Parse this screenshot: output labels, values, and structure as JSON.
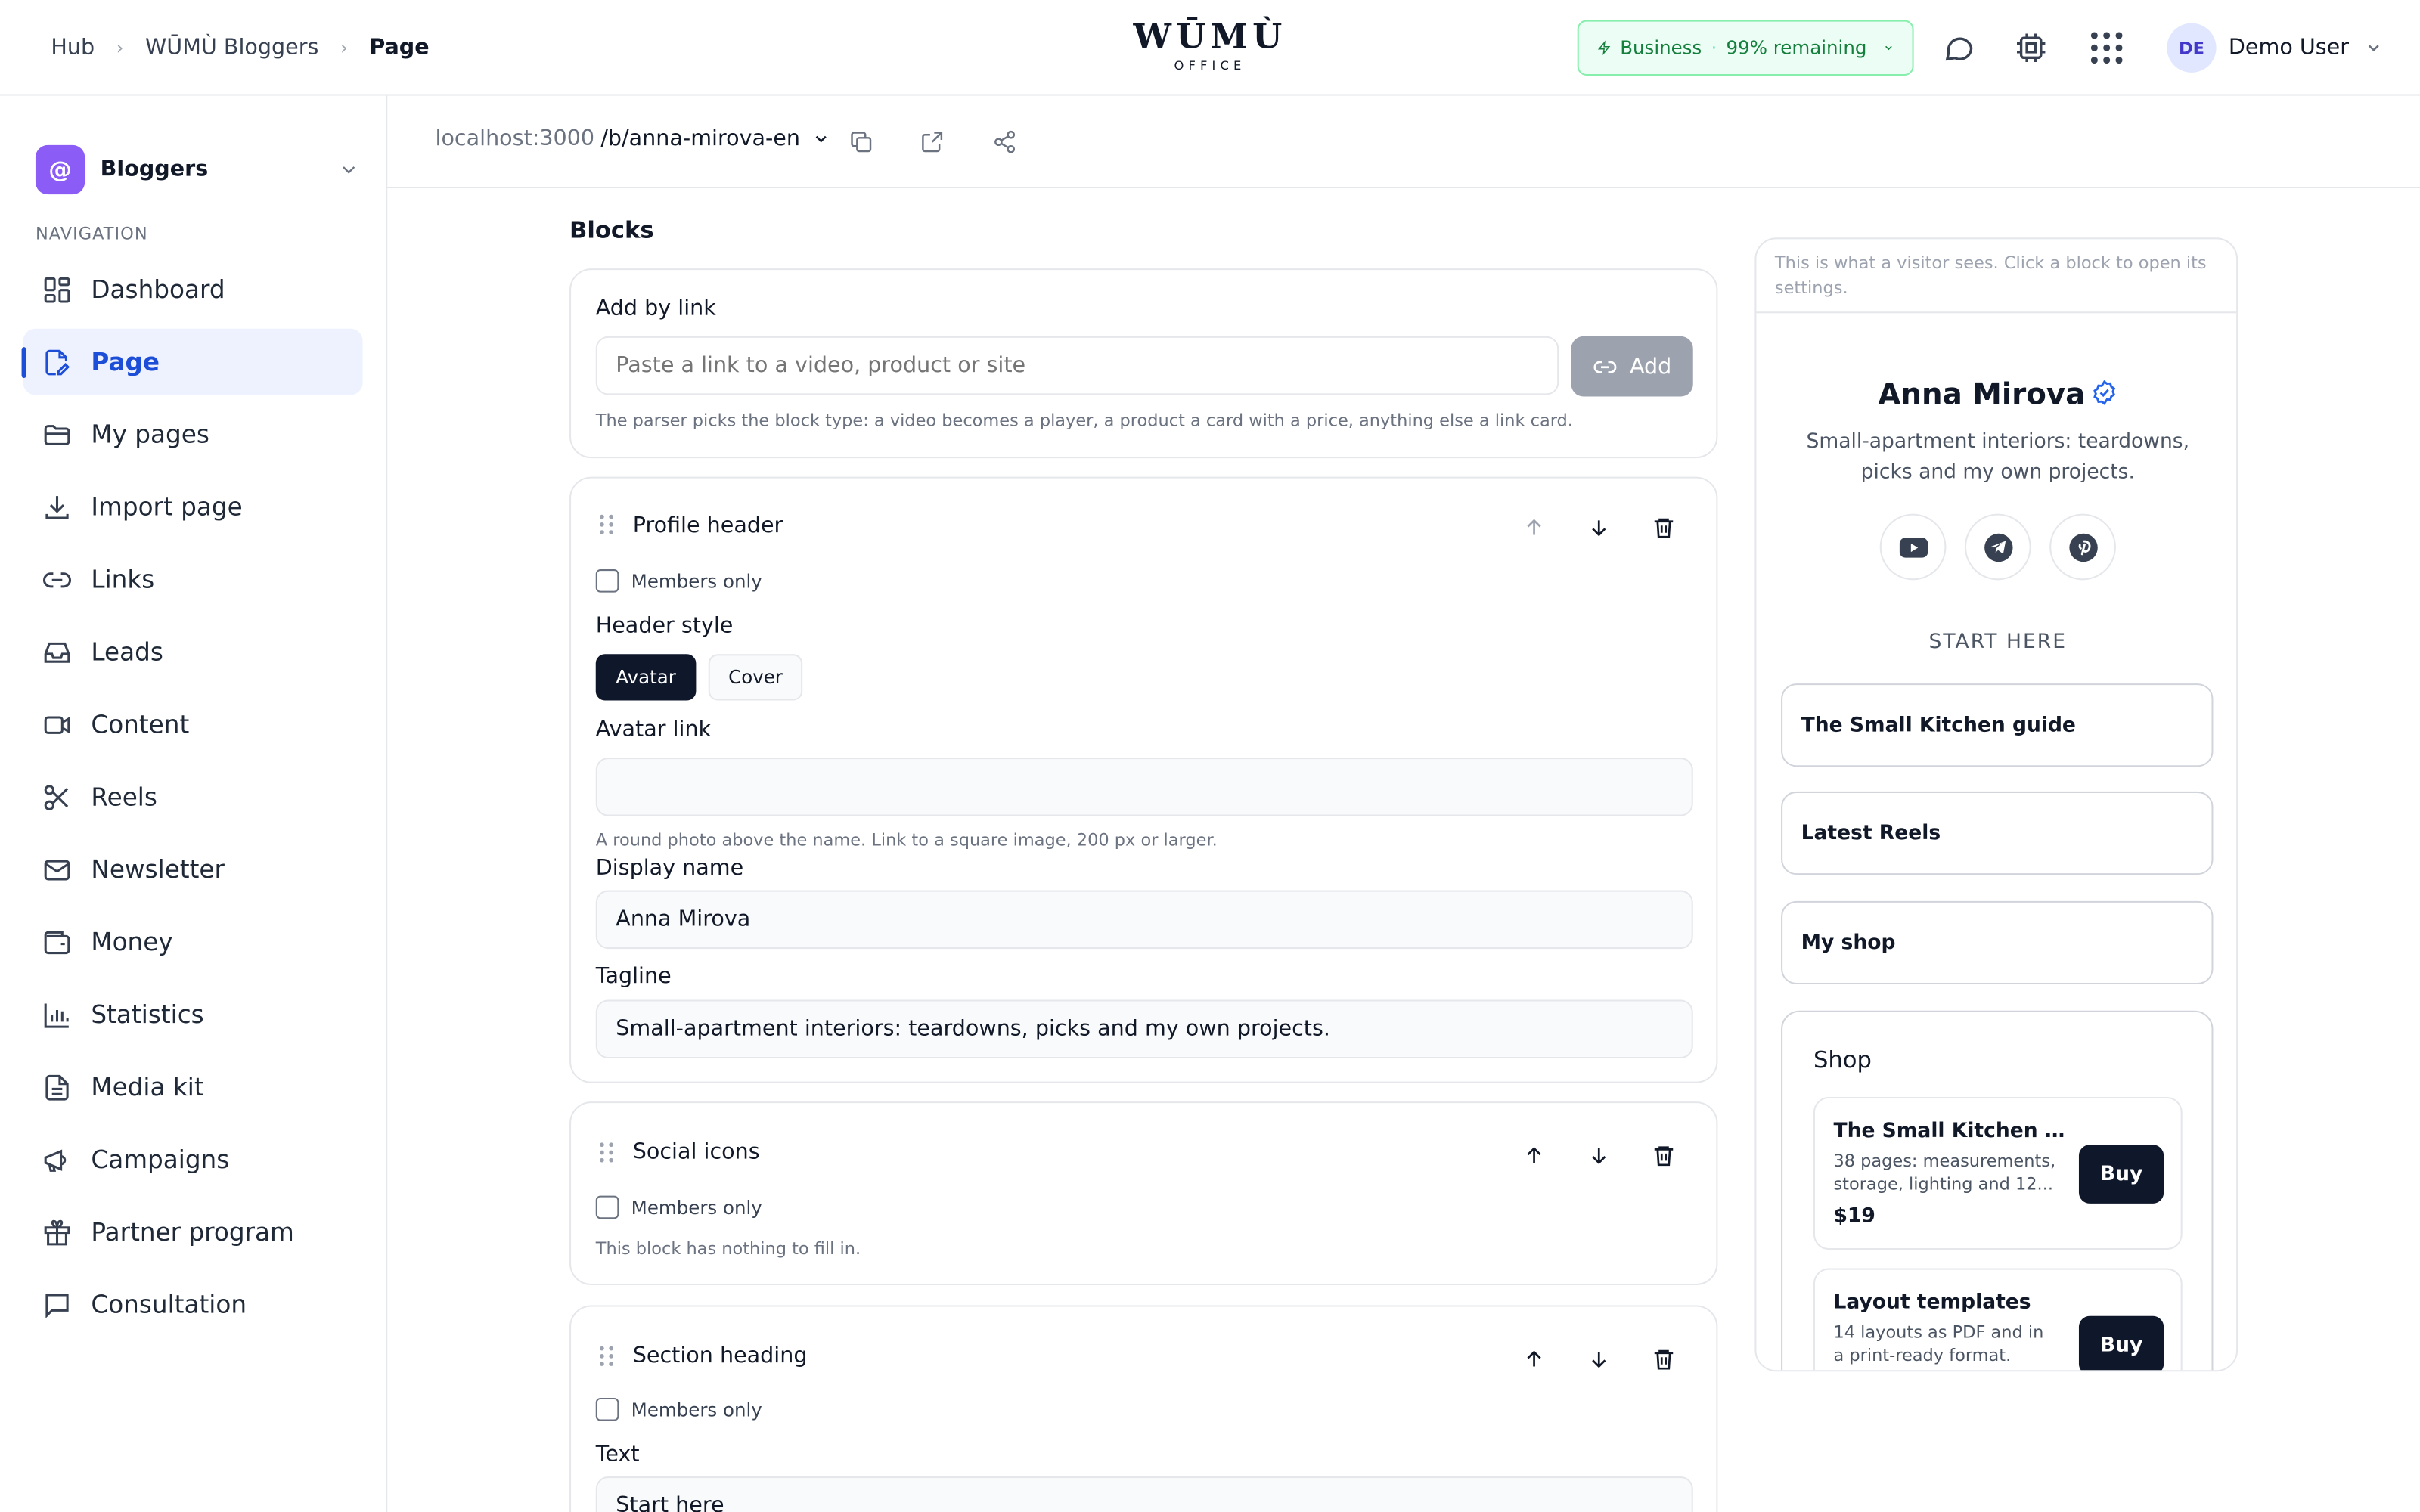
{
  "topbar": {
    "breadcrumb": [
      "Hub",
      "WŪMÙ Bloggers",
      "Page"
    ],
    "logo": "WŪMÙ",
    "logo_sub": "OFFICE",
    "plan": {
      "name": "Business",
      "separator": "·",
      "remaining": "99% remaining"
    },
    "user": {
      "initials": "DE",
      "name": "Demo User"
    }
  },
  "sidebar": {
    "workspace": {
      "icon": "@",
      "name": "Bloggers"
    },
    "nav_label": "NAVIGATION",
    "items": [
      {
        "label": "Dashboard",
        "icon": "dashboard-icon"
      },
      {
        "label": "Page",
        "icon": "page-edit-icon",
        "active": true
      },
      {
        "label": "My pages",
        "icon": "folder-icon"
      },
      {
        "label": "Import page",
        "icon": "download-icon"
      },
      {
        "label": "Links",
        "icon": "link-icon"
      },
      {
        "label": "Leads",
        "icon": "inbox-icon"
      },
      {
        "label": "Content",
        "icon": "video-icon"
      },
      {
        "label": "Reels",
        "icon": "scissors-icon"
      },
      {
        "label": "Newsletter",
        "icon": "mail-icon"
      },
      {
        "label": "Money",
        "icon": "wallet-icon"
      },
      {
        "label": "Statistics",
        "icon": "chart-icon"
      },
      {
        "label": "Media kit",
        "icon": "document-icon"
      },
      {
        "label": "Campaigns",
        "icon": "megaphone-icon"
      },
      {
        "label": "Partner program",
        "icon": "gift-icon"
      },
      {
        "label": "Consultation",
        "icon": "chat-icon"
      }
    ]
  },
  "urlbar": {
    "host": "localhost:3000",
    "path": "/b/anna-mirova-en"
  },
  "main": {
    "title": "Blocks",
    "add_by_link": {
      "label": "Add by link",
      "placeholder": "Paste a link to a video, product or site",
      "button": "Add",
      "hint": "The parser picks the block type: a video becomes a player, a product a card with a price, anything else a link card."
    },
    "profile_header": {
      "title": "Profile header",
      "members_only": "Members only",
      "header_style_label": "Header style",
      "styles": [
        "Avatar",
        "Cover"
      ],
      "avatar_link_label": "Avatar link",
      "avatar_link_value": "",
      "avatar_hint": "A round photo above the name. Link to a square image, 200 px or larger.",
      "display_name_label": "Display name",
      "display_name_value": "Anna Mirova",
      "tagline_label": "Tagline",
      "tagline_value": "Small-apartment interiors: teardowns, picks and my own projects."
    },
    "social_icons": {
      "title": "Social icons",
      "members_only": "Members only",
      "hint": "This block has nothing to fill in."
    },
    "section_heading": {
      "title": "Section heading",
      "members_only": "Members only",
      "text_label": "Text",
      "text_value": "Start here"
    }
  },
  "preview": {
    "note": "This is what a visitor sees. Click a block to open its settings.",
    "name": "Anna Mirova",
    "tagline": "Small-apartment interiors: teardowns, picks and my own projects.",
    "socials": [
      "youtube-icon",
      "telegram-icon",
      "pinterest-icon"
    ],
    "section": "START HERE",
    "links": [
      "The Small Kitchen guide",
      "Latest Reels",
      "My shop"
    ],
    "shop": {
      "title": "Shop",
      "products": [
        {
          "name": "The Small Kitchen gui...",
          "desc": "38 pages: measurements, storage, lighting and 12...",
          "price": "$19",
          "button": "Buy"
        },
        {
          "name": "Layout templates",
          "desc": "14 layouts as PDF and in a print-ready format.",
          "button": "Buy"
        }
      ]
    }
  },
  "colors": {
    "accent": "#1d4ed8",
    "dark_button": "#0f172a",
    "plan_green": "#15803d",
    "workspace": "#8b5cf6"
  }
}
